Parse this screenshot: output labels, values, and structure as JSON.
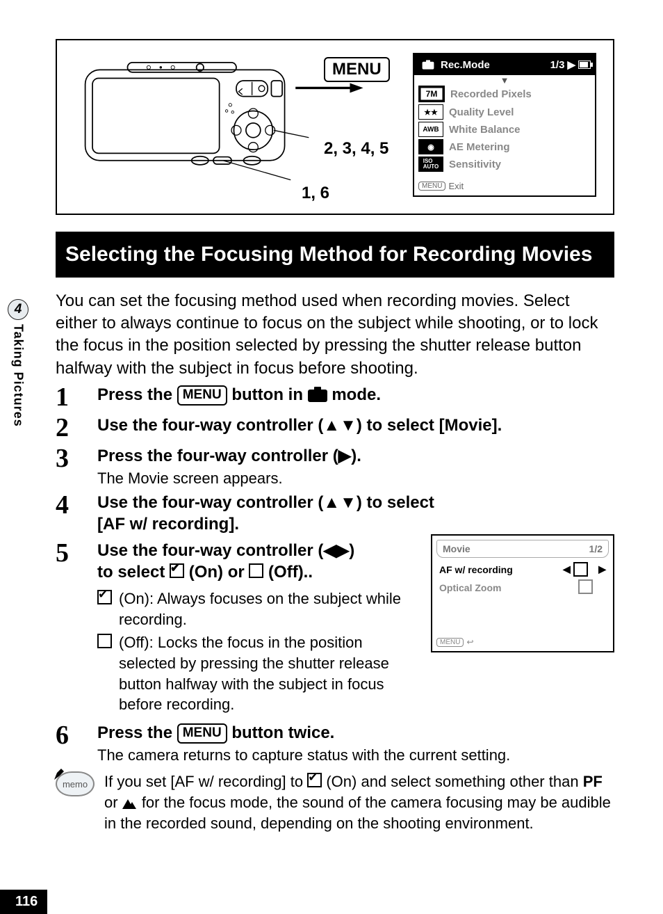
{
  "sidebar": {
    "chapter": "4",
    "label": "Taking Pictures"
  },
  "pageNumber": "116",
  "diagram": {
    "menuLabel": "MENU",
    "lead235": "2, 3, 4, 5",
    "lead16": "1, 6"
  },
  "lcdRec": {
    "title": "Rec.Mode",
    "page": "1/3",
    "rows": [
      {
        "icon": "7M",
        "label": "Recorded Pixels",
        "sel": true
      },
      {
        "icon": "★★",
        "label": "Quality Level"
      },
      {
        "icon": "AWB",
        "label": "White Balance"
      },
      {
        "icon": "◎",
        "label": "AE Metering"
      },
      {
        "icon": "ISO AUTO",
        "label": "Sensitivity"
      }
    ],
    "footBtn": "MENU",
    "footLabel": "Exit"
  },
  "sectionTitle": "Selecting the Focusing Method for Recording Movies",
  "intro": "You can set the focusing method used when recording movies. Select either to always continue to focus on the subject while shooting, or to lock the focus in the position selected by pressing the shutter release button halfway with the subject in focus before shooting.",
  "steps": {
    "s1": {
      "num": "1",
      "pre": "Press the ",
      "btn": "MENU",
      "mid": " button in ",
      "post": " mode."
    },
    "s2": {
      "num": "2",
      "text": "Use the four-way controller (▲▼) to select [Movie]."
    },
    "s3": {
      "num": "3",
      "title": "Press the four-way controller (▶).",
      "sub": "The Movie screen appears."
    },
    "s4": {
      "num": "4",
      "text": "Use the four-way controller (▲▼) to select [AF w/ recording]."
    },
    "s5": {
      "num": "5",
      "line1a": "Use the four-way controller (◀▶)",
      "line2a": "to select ",
      "onLabel": " (On) or ",
      "offLabel": "(Off)..",
      "bulletOn": "(On): Always focuses on the subject while recording.",
      "bulletOff": "(Off): Locks the focus in the position selected by pressing the shutter release button halfway with the subject in focus before recording."
    },
    "s6": {
      "num": "6",
      "pre": "Press the ",
      "btn": "MENU",
      "post": " button twice.",
      "sub": "The camera returns to capture status with the current setting."
    }
  },
  "lcdMovie": {
    "title": "Movie",
    "page": "1/2",
    "row1": "AF w/ recording",
    "row2": "Optical Zoom",
    "footBtn": "MENU"
  },
  "memo": {
    "label": "memo",
    "pre": "If you set [AF w/ recording] to ",
    "mid1": " (On) and select something other than ",
    "pf": "PF",
    "or": " or ",
    "post": " for the focus mode, the sound of the camera focusing may be audible in the recorded sound, depending on the shooting environment."
  }
}
